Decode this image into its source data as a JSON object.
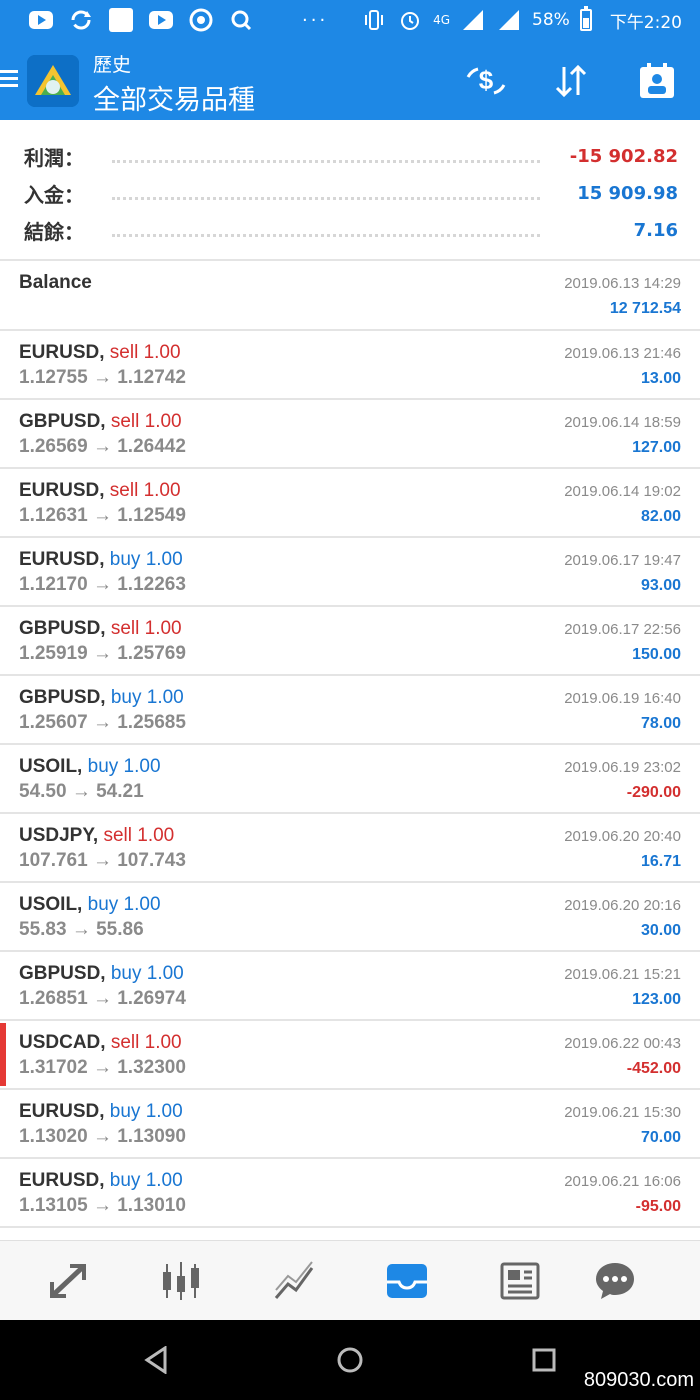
{
  "status_bar": {
    "battery": "58%",
    "time": "下午2:20",
    "dots": "···",
    "signal_1": "4G",
    "icons": [
      "youtube-icon",
      "sync-icon",
      "square-icon",
      "youtube-icon",
      "chrome-icon",
      "search-icon",
      "vibrate-icon",
      "alarm-icon",
      "signal-icon",
      "battery-icon"
    ]
  },
  "header": {
    "subtitle": "歷史",
    "title": "全部交易品種",
    "actions": [
      "currency-exchange-icon",
      "sort-icon",
      "calendar-icon"
    ]
  },
  "summary": [
    {
      "label": "利潤：",
      "value": "-15 902.82",
      "tone": "neg"
    },
    {
      "label": "入金：",
      "value": "15 909.98",
      "tone": "pos"
    },
    {
      "label": "結餘：",
      "value": "7.16",
      "tone": "pos"
    }
  ],
  "balance_row": {
    "label": "Balance",
    "date": "2019.06.13 14:29",
    "amount": "12 712.54"
  },
  "trades": [
    {
      "symbol": "EURUSD,",
      "side": "sell 1.00",
      "type": "sell",
      "price": "1.12755 → 1.12742",
      "date": "2019.06.13 21:46",
      "profit": "13.00",
      "tone": "pos"
    },
    {
      "symbol": "GBPUSD,",
      "side": "sell 1.00",
      "type": "sell",
      "price": "1.26569 → 1.26442",
      "date": "2019.06.14 18:59",
      "profit": "127.00",
      "tone": "pos"
    },
    {
      "symbol": "EURUSD,",
      "side": "sell 1.00",
      "type": "sell",
      "price": "1.12631 → 1.12549",
      "date": "2019.06.14 19:02",
      "profit": "82.00",
      "tone": "pos"
    },
    {
      "symbol": "EURUSD,",
      "side": "buy 1.00",
      "type": "buy",
      "price": "1.12170 → 1.12263",
      "date": "2019.06.17 19:47",
      "profit": "93.00",
      "tone": "pos"
    },
    {
      "symbol": "GBPUSD,",
      "side": "sell 1.00",
      "type": "sell",
      "price": "1.25919 → 1.25769",
      "date": "2019.06.17 22:56",
      "profit": "150.00",
      "tone": "pos"
    },
    {
      "symbol": "GBPUSD,",
      "side": "buy 1.00",
      "type": "buy",
      "price": "1.25607 → 1.25685",
      "date": "2019.06.19 16:40",
      "profit": "78.00",
      "tone": "pos"
    },
    {
      "symbol": "USOIL,",
      "side": "buy 1.00",
      "type": "buy",
      "price": "54.50 → 54.21",
      "date": "2019.06.19 23:02",
      "profit": "-290.00",
      "tone": "neg"
    },
    {
      "symbol": "USDJPY,",
      "side": "sell 1.00",
      "type": "sell",
      "price": "107.761 → 107.743",
      "date": "2019.06.20 20:40",
      "profit": "16.71",
      "tone": "pos"
    },
    {
      "symbol": "USOIL,",
      "side": "buy 1.00",
      "type": "buy",
      "price": "55.83 → 55.86",
      "date": "2019.06.20 20:16",
      "profit": "30.00",
      "tone": "pos"
    },
    {
      "symbol": "GBPUSD,",
      "side": "buy 1.00",
      "type": "buy",
      "price": "1.26851 → 1.26974",
      "date": "2019.06.21 15:21",
      "profit": "123.00",
      "tone": "pos"
    },
    {
      "symbol": "USDCAD,",
      "side": "sell 1.00",
      "type": "sell",
      "price": "1.31702 → 1.32300",
      "date": "2019.06.22 00:43",
      "profit": "-452.00",
      "tone": "neg",
      "highlight": true
    },
    {
      "symbol": "EURUSD,",
      "side": "buy 1.00",
      "type": "buy",
      "price": "1.13020 → 1.13090",
      "date": "2019.06.21 15:30",
      "profit": "70.00",
      "tone": "pos"
    },
    {
      "symbol": "EURUSD,",
      "side": "buy 1.00",
      "type": "buy",
      "price": "1.13105 → 1.13010",
      "date": "2019.06.21 16:06",
      "profit": "-95.00",
      "tone": "neg"
    }
  ],
  "bottom_nav": [
    "quotes-icon",
    "chart-icon",
    "trade-icon",
    "history-icon",
    "news-icon",
    "chat-icon"
  ],
  "bottom_nav_active": "history-icon",
  "system_nav": [
    "back-icon",
    "home-icon",
    "recents-icon"
  ],
  "watermark": "809030.com",
  "colors": {
    "primary": "#1e88e5",
    "loss": "#d32f2f",
    "profit": "#1976d2",
    "active_nav": "#1e88e5"
  }
}
